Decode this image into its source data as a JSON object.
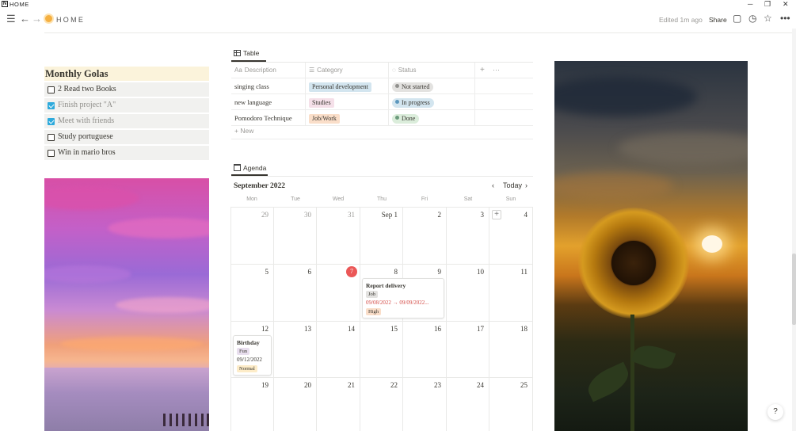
{
  "window": {
    "title": "HOME",
    "logo": "N"
  },
  "topbar": {
    "breadcrumb_title": "HOME",
    "edited": "Edited 1m ago",
    "share": "Share"
  },
  "goals": {
    "title": "Monthly Golas",
    "items": [
      {
        "label": "2 Read two Books",
        "checked": false
      },
      {
        "label": "Finish project \"A\"",
        "checked": true
      },
      {
        "label": "Meet with friends",
        "checked": true
      },
      {
        "label": "Study portuguese",
        "checked": false
      },
      {
        "label": "Win in mario bros",
        "checked": false
      }
    ]
  },
  "table": {
    "tab_label": "Table",
    "headers": [
      "Description",
      "Category",
      "Status"
    ],
    "rows": [
      {
        "description": "singing class",
        "category": "Personal development",
        "status": "Not started"
      },
      {
        "description": "new language",
        "category": "Studies",
        "status": "In progress"
      },
      {
        "description": "Pomodoro Technique",
        "category": "Job/Work",
        "status": "Done"
      }
    ],
    "new_label": "New",
    "colors": {
      "personal_development": "#d3e5ef",
      "studies": "#f5e0e9",
      "job_work": "#fadec9",
      "not_started": "#e3e2e0",
      "in_progress": "#d3e5ef",
      "done": "#dbeddb"
    }
  },
  "agenda": {
    "tab_label": "Agenda",
    "month": "September 2022",
    "today_label": "Today",
    "weekdays": [
      "Mon",
      "Tue",
      "Wed",
      "Thu",
      "Fri",
      "Sat",
      "Sun"
    ],
    "weeks": [
      [
        "29",
        "30",
        "31",
        "Sep 1",
        "2",
        "3",
        "4"
      ],
      [
        "5",
        "6",
        "7",
        "8",
        "9",
        "10",
        "11"
      ],
      [
        "12",
        "13",
        "14",
        "15",
        "16",
        "17",
        "18"
      ],
      [
        "19",
        "20",
        "21",
        "22",
        "23",
        "24",
        "25"
      ]
    ],
    "events": {
      "report": {
        "title": "Report delivery",
        "tag": "Job",
        "dates": "09/08/2022 → 09/09/2022...",
        "priority": "High"
      },
      "birthday": {
        "title": "Birthday",
        "tag": "Fun",
        "date": "09/12/2022",
        "priority": "Normal"
      }
    },
    "today_color": "#eb5757"
  },
  "help": "?"
}
